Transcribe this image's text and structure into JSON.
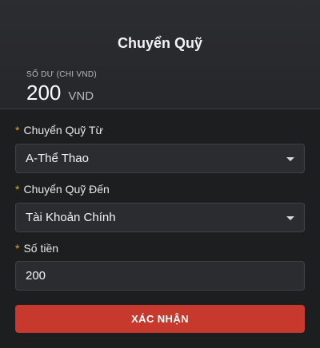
{
  "header": {
    "title": "Chuyển Quỹ"
  },
  "balance": {
    "label": "SỐ DƯ (CHI VND)",
    "amount": "200",
    "unit": "VND"
  },
  "form": {
    "from": {
      "required": "*",
      "label": "Chuyển Quỹ Từ",
      "value": "A-Thể Thao"
    },
    "to": {
      "required": "*",
      "label": "Chuyển Quỹ Đến",
      "value": "Tài Khoản Chính"
    },
    "amount": {
      "required": "*",
      "label": "Số tiền",
      "value": "200"
    }
  },
  "confirm_label": "XÁC NHẬN",
  "colors": {
    "accent": "#c6392c",
    "required_marker": "#e2a32a",
    "background": "#1d1e20"
  },
  "icons": {
    "select_caret": "caret-down-icon"
  }
}
